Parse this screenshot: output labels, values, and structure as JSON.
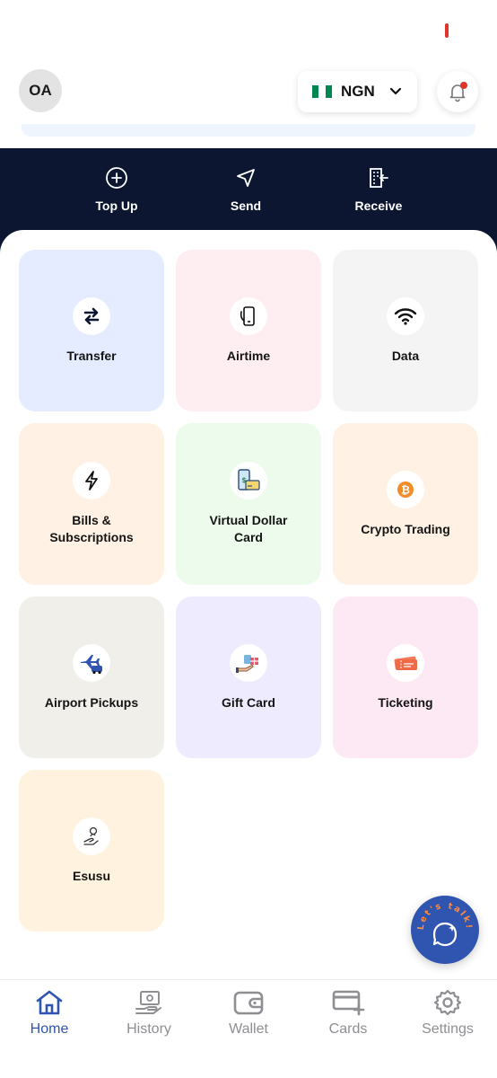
{
  "header": {
    "avatar_initials": "OA",
    "currency": {
      "code": "NGN",
      "flag_colors": [
        "#008751",
        "#ffffff",
        "#008751"
      ]
    },
    "notification_badge_color": "#e0342b"
  },
  "quick_actions": [
    {
      "label": "Top Up",
      "icon": "plus-circle-icon"
    },
    {
      "label": "Send",
      "icon": "send-arrow-icon"
    },
    {
      "label": "Receive",
      "icon": "receive-icon"
    }
  ],
  "services": [
    {
      "label": "Transfer",
      "icon": "transfer-arrows-icon",
      "bg": "#e5ecff"
    },
    {
      "label": "Airtime",
      "icon": "phone-call-icon",
      "bg": "#ffeef1"
    },
    {
      "label": "Data",
      "icon": "wifi-icon",
      "bg": "#f4f4f4"
    },
    {
      "label": "Bills & Subscriptions",
      "icon": "lightning-icon",
      "bg": "#fff1e3"
    },
    {
      "label": "Virtual Dollar Card",
      "icon": "phone-card-icon",
      "bg": "#ecfbec"
    },
    {
      "label": "Crypto Trading",
      "icon": "bitcoin-icon",
      "bg": "#fff2e4"
    },
    {
      "label": "Airport Pickups",
      "icon": "plane-car-icon",
      "bg": "#f1efea"
    },
    {
      "label": "Gift Card",
      "icon": "gift-card-icon",
      "bg": "#eeebff"
    },
    {
      "label": "Ticketing",
      "icon": "ticket-icon",
      "bg": "#fde9f3"
    },
    {
      "label": "Esusu",
      "icon": "hand-coin-icon",
      "bg": "#fff2de"
    }
  ],
  "chat_button": {
    "label": "Let's talk!"
  },
  "bottom_nav": [
    {
      "label": "Home",
      "icon": "home-icon",
      "active": true
    },
    {
      "label": "History",
      "icon": "history-icon",
      "active": false
    },
    {
      "label": "Wallet",
      "icon": "wallet-icon",
      "active": false
    },
    {
      "label": "Cards",
      "icon": "cards-icon",
      "active": false
    },
    {
      "label": "Settings",
      "icon": "gear-icon",
      "active": false
    }
  ],
  "colors": {
    "brand": "#2f55b0",
    "dark_band": "#0c1631",
    "inactive": "#8e8e93"
  }
}
